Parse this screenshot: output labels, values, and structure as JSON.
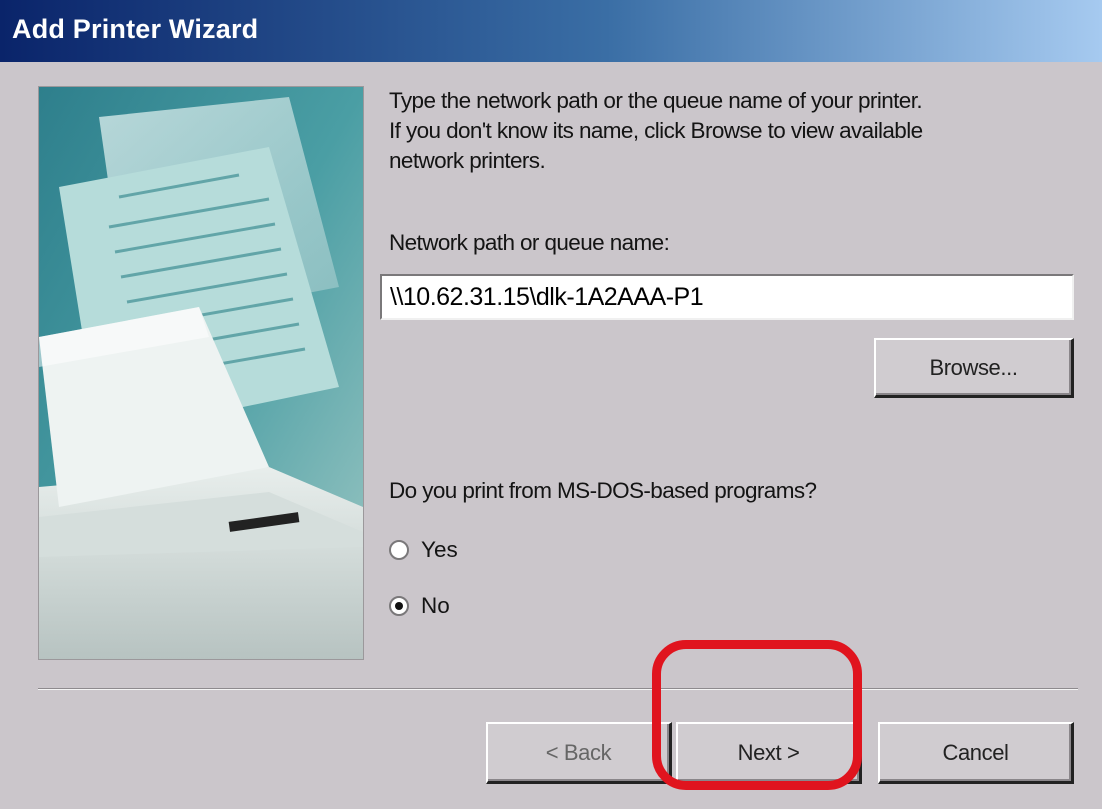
{
  "window": {
    "title": "Add Printer Wizard"
  },
  "instructions": "Type the network path or the queue name of your printer.\nIf you don't know its name, click Browse to view available\nnetwork printers.",
  "path_field": {
    "label": "Network path or queue name:",
    "value": "\\\\10.62.31.15\\dlk-1A2AAA-P1"
  },
  "browse_button": "Browse...",
  "msdos": {
    "question": "Do you print from MS-DOS-based programs?",
    "options": [
      {
        "label": "Yes",
        "selected": false
      },
      {
        "label": "No",
        "selected": true
      }
    ]
  },
  "footer": {
    "back": "< Back",
    "next": "Next >",
    "cancel": "Cancel"
  },
  "colors": {
    "title_bar_start": "#0a246a",
    "title_bar_end": "#a6caf0",
    "dialog_background": "#cbc6cb",
    "highlight": "#e0141e"
  },
  "icons": {
    "wizard_image": "printer-documents-illustration"
  }
}
